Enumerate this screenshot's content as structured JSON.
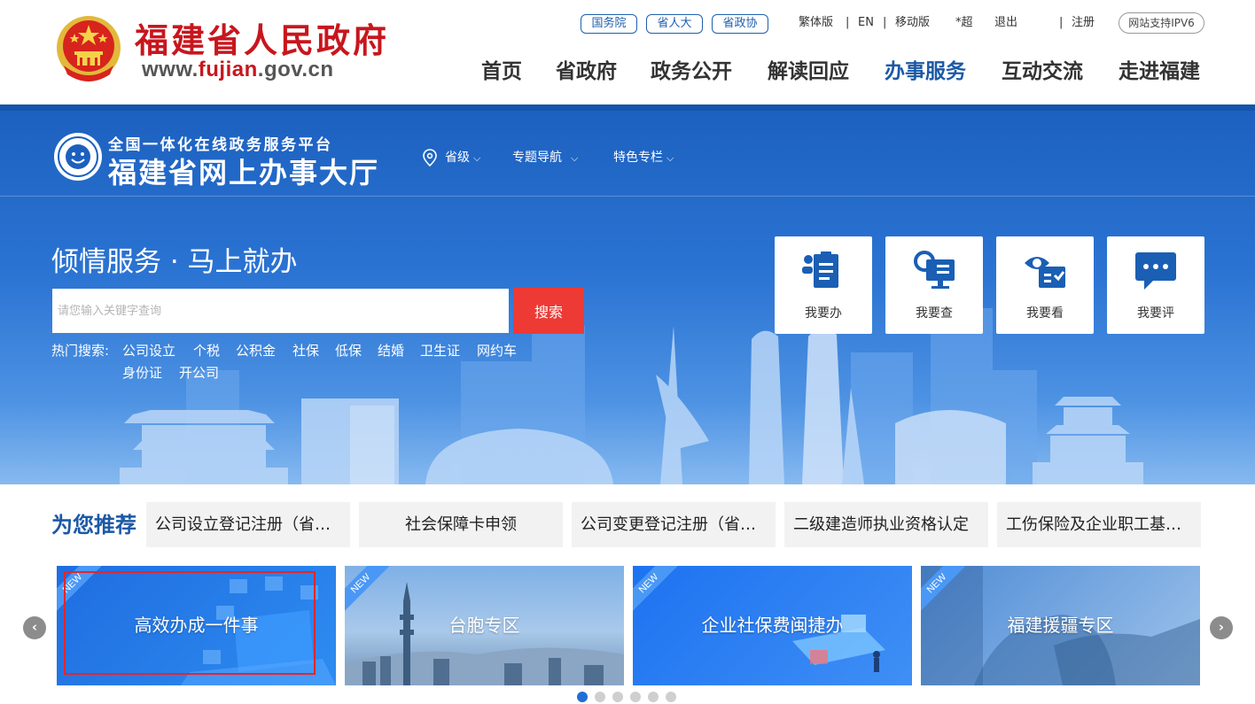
{
  "header": {
    "site_name": "福建省人民政府",
    "site_url_prefix": "www.",
    "site_url_highlight": "fujian",
    "site_url_suffix": ".gov.cn",
    "org_links": [
      "国务院",
      "省人大",
      "省政协"
    ],
    "util_links": [
      "繁体版",
      "EN",
      "移动版",
      "*超",
      "退出",
      "注册"
    ],
    "ipv6": "网站支持IPV6",
    "nav": [
      "首页",
      "省政府",
      "政务公开",
      "解读回应",
      "办事服务",
      "互动交流",
      "走进福建"
    ],
    "active_nav": "办事服务"
  },
  "platform": {
    "subtitle": "全国一体化在线政务服务平台",
    "title": "福建省网上办事大厅",
    "nav": [
      {
        "label": "省级",
        "has_dropdown": true
      },
      {
        "label": "专题导航",
        "has_dropdown": true
      },
      {
        "label": "特色专栏",
        "has_dropdown": true
      }
    ]
  },
  "hero": {
    "slogan": "倾情服务 · 马上就办",
    "search_placeholder": "请您输入关键字查询",
    "search_button": "搜索",
    "hot_label": "热门搜索:",
    "hot_terms": [
      "公司设立",
      "个税",
      "公积金",
      "社保",
      "低保",
      "结婚",
      "卫生证",
      "网约车",
      "身份证",
      "开公司"
    ]
  },
  "quick_actions": [
    {
      "label": "我要办",
      "icon": "clipboard-icon"
    },
    {
      "label": "我要查",
      "icon": "search-screen-icon"
    },
    {
      "label": "我要看",
      "icon": "view-check-icon"
    },
    {
      "label": "我要评",
      "icon": "comment-icon"
    }
  ],
  "recommend": {
    "title": "为您推荐",
    "items": [
      "公司设立登记注册（省级）",
      "社会保障卡申领",
      "公司变更登记注册（省级）",
      "二级建造师执业资格认定",
      "工伤保险及企业职工基本养老保险"
    ]
  },
  "features": [
    {
      "title": "高效办成一件事",
      "badge": "NEW"
    },
    {
      "title": "台胞专区",
      "badge": "NEW"
    },
    {
      "title": "企业社保费闽捷办",
      "badge": "NEW"
    },
    {
      "title": "福建援疆专区",
      "badge": "NEW"
    }
  ],
  "carousel": {
    "prev": "‹",
    "next": "›",
    "pages": 6,
    "active_page": 1
  },
  "colors": {
    "brand_red": "#c8161d",
    "brand_blue": "#1c59a6",
    "search_red": "#ed3a34",
    "dot_active": "#1f6fd6"
  }
}
